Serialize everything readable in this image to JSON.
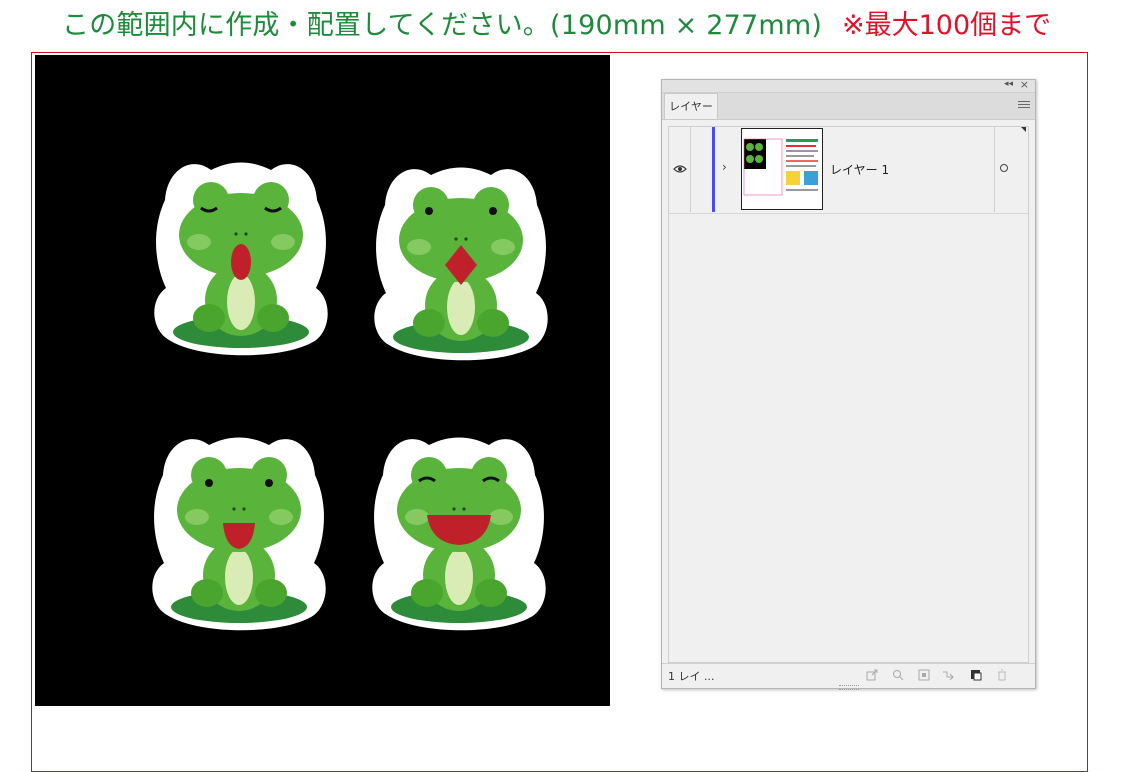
{
  "header": {
    "instruction": "この範囲内に作成・配置してください。(190mm × 277mm)",
    "limit_note": "※最大100個まで"
  },
  "artboard": {
    "background": "#000000",
    "sticker_outline": "#ffffff",
    "frog_green": "#5ab33a",
    "lily_pad": "#2e8b3a",
    "mouth_red": "#c0202a"
  },
  "layers_panel": {
    "tab_label": "レイヤー",
    "layers": [
      {
        "name": "レイヤー 1",
        "color": "#4a4af0",
        "visible": true
      }
    ],
    "footer_count": "1 レイ ..."
  },
  "colors": {
    "title_green": "#1e8a3c",
    "note_red": "#e0102a",
    "frame_border": "#c8102e"
  }
}
